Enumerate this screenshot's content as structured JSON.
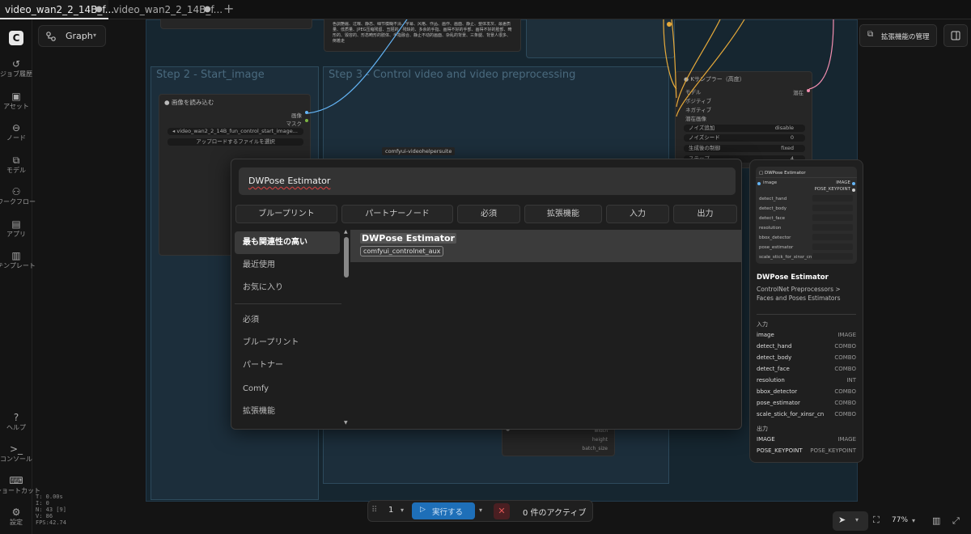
{
  "tabs": [
    {
      "label": "video_wan2_2_14B_f...",
      "modified": "●",
      "active": true
    },
    {
      "label": "video_wan2_2_14B_f...",
      "modified": "●",
      "active": false
    }
  ],
  "add_tab": "+",
  "app": {
    "mode_label": "Graph"
  },
  "sidebar": {
    "items": [
      {
        "label": "ジョブ履歴",
        "icon": "history-icon"
      },
      {
        "label": "アセット",
        "icon": "image-icon"
      },
      {
        "label": "ノード",
        "icon": "node-icon"
      },
      {
        "label": "モデル",
        "icon": "cube-icon"
      },
      {
        "label": "ワークフロー",
        "icon": "workflow-icon"
      },
      {
        "label": "アプリ",
        "icon": "app-icon"
      },
      {
        "label": "テンプレート",
        "icon": "template-icon"
      }
    ],
    "bottom": [
      {
        "label": "ヘルプ",
        "icon": "help-icon"
      },
      {
        "label": "コンソール",
        "icon": "console-icon"
      },
      {
        "label": "ショートカット",
        "icon": "keyboard-icon"
      },
      {
        "label": "設定",
        "icon": "gear-icon"
      }
    ],
    "stats": [
      "T: 0.00s",
      "I: 0",
      "N: 43 [9]",
      "V: 86",
      "FPS:42.74"
    ]
  },
  "canvas": {
    "group_step2": "Step 2 - Start_image",
    "group_step3": "Step 3 - Control video and video preprocessing",
    "load_image_node": {
      "title": "画像を読み込む",
      "out_image": "画像",
      "out_mask": "マスク",
      "file": "video_wan2_2_14B_fun_control_start_image...",
      "upload": "アップロードするファイルを選択"
    },
    "vhs_badge": "comfyui-videohelpersuite",
    "prompt_text": "色調艶麗、过曝、静态、细节模糊不清、字幕、风格、作品、画作、画面、静止、整体发灰、最差质量、低质量、JPEG压缩残留、丑陋的、残缺的、多余的手指、画得不好的手部、画得不好的脸部、畸形的、毁容的、形态畸形的肢体、手指融合、静止不动的画面、杂乱的背景、三条腿、背景人很多、倒着走",
    "ksampler": {
      "title": "Kサンプラー（高度）",
      "inputs": [
        "モデル",
        "ポジティブ",
        "ネガティブ",
        "潜在画像"
      ],
      "output": "潜在",
      "widgets": [
        {
          "label": "ノイズ追加",
          "value": "disable"
        },
        {
          "label": "ノイズシード",
          "value": "0"
        },
        {
          "label": "生成後の制御",
          "value": "fixed"
        },
        {
          "label": "ステップ",
          "value": "4"
        }
      ]
    },
    "bottom_node_outputs": [
      "width",
      "height",
      "batch_size"
    ]
  },
  "topright": {
    "extensions_button": "拡張機能の管理"
  },
  "search_dialog": {
    "query": "DWPose Estimator",
    "filter_tabs": [
      "ブループリント",
      "パートナーノード",
      "必須",
      "拡張機能",
      "入力",
      "出力"
    ],
    "categories_top": [
      "最も関連性の高い",
      "最近使用",
      "お気に入り"
    ],
    "categories_bottom": [
      "必須",
      "ブループリント",
      "パートナー",
      "Comfy",
      "拡張機能"
    ],
    "result": {
      "title": "DWPose Estimator",
      "badge": "comfyui_controlnet_aux"
    }
  },
  "preview": {
    "node_title": "DWPose Estimator",
    "node_input": "image",
    "node_outputs": [
      "IMAGE",
      "POSE_KEYPOINT"
    ],
    "node_widgets": [
      "detect_hand",
      "detect_body",
      "detect_face",
      "resolution",
      "bbox_detector",
      "pose_estimator",
      "scale_stick_for_xinsr_cn"
    ],
    "title": "DWPose Estimator",
    "category": "ControlNet Preprocessors > Faces and Poses Estimators",
    "inputs_header": "入力",
    "inputs": [
      {
        "name": "image",
        "type": "IMAGE"
      },
      {
        "name": "detect_hand",
        "type": "COMBO"
      },
      {
        "name": "detect_body",
        "type": "COMBO"
      },
      {
        "name": "detect_face",
        "type": "COMBO"
      },
      {
        "name": "resolution",
        "type": "INT"
      },
      {
        "name": "bbox_detector",
        "type": "COMBO"
      },
      {
        "name": "pose_estimator",
        "type": "COMBO"
      },
      {
        "name": "scale_stick_for_xinsr_cn",
        "type": "COMBO"
      }
    ],
    "outputs_header": "出力",
    "outputs": [
      {
        "name": "IMAGE",
        "type": "IMAGE"
      },
      {
        "name": "POSE_KEYPOINT",
        "type": "POSE_KEYPOINT"
      }
    ]
  },
  "runbar": {
    "count": "1",
    "run_label": "実行する",
    "active_label": "0 件のアクティブ"
  },
  "bottomright": {
    "zoom": "77%"
  }
}
